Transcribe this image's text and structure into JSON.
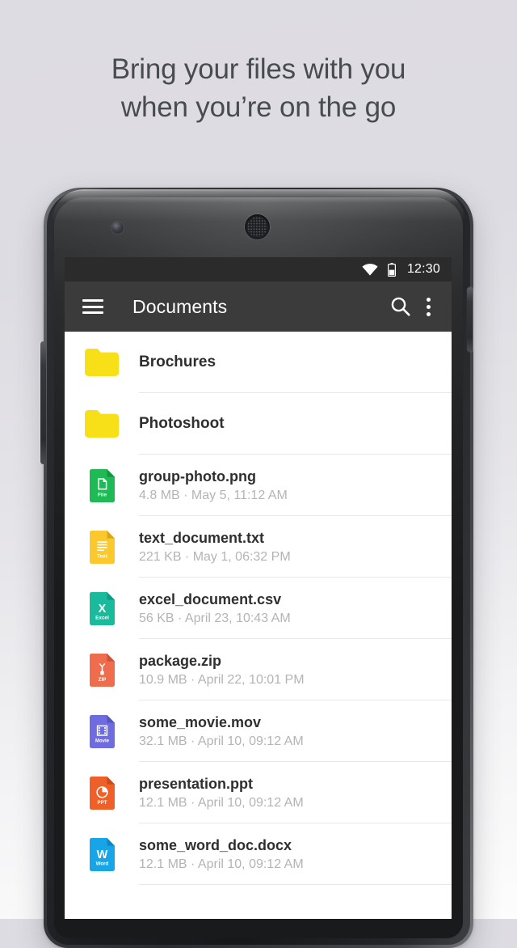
{
  "headline": {
    "line1": "Bring your files with you",
    "line2": "when you’re on the go"
  },
  "phone": {
    "hardware": {
      "front_camera": "front-camera",
      "earpiece": "earpiece-speaker",
      "volume_button": "volume-rocker",
      "power_button": "power-button"
    }
  },
  "status_bar": {
    "wifi_icon": "wifi-icon",
    "battery_icon": "battery-icon",
    "time": "12:30"
  },
  "app_bar": {
    "menu_icon": "hamburger-menu-icon",
    "title": "Documents",
    "search_icon": "search-icon",
    "overflow_icon": "overflow-menu-icon"
  },
  "colors": {
    "status_bar_bg": "#2b2b2b",
    "app_bar_bg": "#3b3b3b",
    "page_bg_top": "#dedce3",
    "page_bg_bottom": "#fdfdfd",
    "headline_text": "#474c52",
    "row_name_text": "#2f2f2f",
    "row_meta_text": "#b4b4b4",
    "divider": "#e8e8e8",
    "folder_yellow": "#f7e018",
    "file_green": "#1fb955",
    "text_yellow": "#fbc82e",
    "excel_teal": "#19bb9c",
    "zip_orange": "#ef6c4c",
    "movie_purple": "#6f6ce0",
    "ppt_orange": "#ef5f28",
    "word_blue": "#18a5e8"
  },
  "files": [
    {
      "type": "folder",
      "icon": "folder-icon",
      "icon_color": "#f7e018",
      "badge": "",
      "name": "Brochures",
      "meta": ""
    },
    {
      "type": "folder",
      "icon": "folder-icon",
      "icon_color": "#f7e018",
      "badge": "",
      "name": "Photoshoot",
      "meta": ""
    },
    {
      "type": "file",
      "icon": "image-file-icon",
      "icon_color": "#1fb955",
      "badge": "File",
      "name": "group-photo.png",
      "meta": "4.8 MB · May 5, 11:12 AM"
    },
    {
      "type": "file",
      "icon": "text-file-icon",
      "icon_color": "#fbc82e",
      "badge": "Text",
      "name": "text_document.txt",
      "meta": "221 KB · May 1, 06:32 PM"
    },
    {
      "type": "file",
      "icon": "excel-file-icon",
      "icon_color": "#19bb9c",
      "badge": "Excel",
      "name": "excel_document.csv",
      "meta": "56 KB · April 23, 10:43 AM"
    },
    {
      "type": "file",
      "icon": "zip-file-icon",
      "icon_color": "#ef6c4c",
      "badge": "ZIP",
      "name": "package.zip",
      "meta": "10.9 MB · April 22, 10:01 PM"
    },
    {
      "type": "file",
      "icon": "movie-file-icon",
      "icon_color": "#6f6ce0",
      "badge": "Movie",
      "name": "some_movie.mov",
      "meta": "32.1 MB · April 10, 09:12 AM"
    },
    {
      "type": "file",
      "icon": "powerpoint-file-icon",
      "icon_color": "#ef5f28",
      "badge": "PPT",
      "name": "presentation.ppt",
      "meta": "12.1 MB · April 10, 09:12 AM"
    },
    {
      "type": "file",
      "icon": "word-file-icon",
      "icon_color": "#18a5e8",
      "badge": "Word",
      "name": "some_word_doc.docx",
      "meta": "12.1 MB · April 10, 09:12 AM"
    }
  ]
}
